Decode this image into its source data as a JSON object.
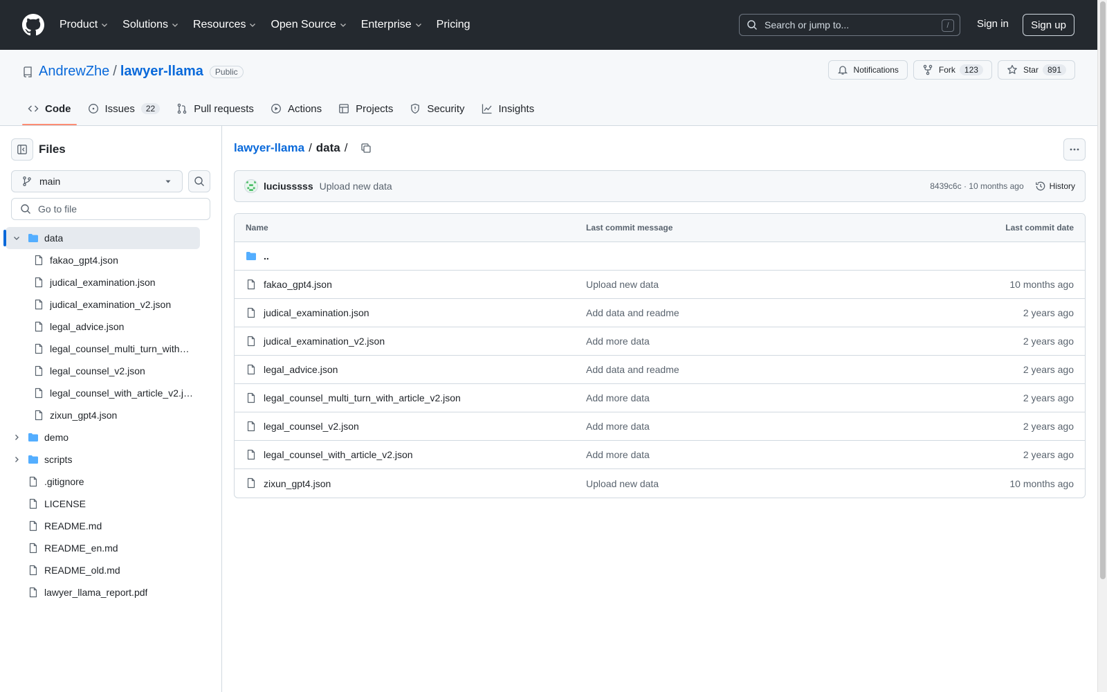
{
  "header": {
    "nav": [
      "Product",
      "Solutions",
      "Resources",
      "Open Source",
      "Enterprise",
      "Pricing"
    ],
    "search_placeholder": "Search or jump to...",
    "search_hint": "/",
    "sign_in": "Sign in",
    "sign_up": "Sign up"
  },
  "repo": {
    "owner": "AndrewZhe",
    "separator": "/",
    "name": "lawyer-llama",
    "visibility": "Public",
    "notifications_label": "Notifications",
    "fork_label": "Fork",
    "fork_count": "123",
    "star_label": "Star",
    "star_count": "891",
    "tabs": {
      "code": "Code",
      "issues": "Issues",
      "issues_count": "22",
      "pulls": "Pull requests",
      "actions": "Actions",
      "projects": "Projects",
      "security": "Security",
      "insights": "Insights"
    }
  },
  "sidebar": {
    "title": "Files",
    "branch": "main",
    "goto_placeholder": "Go to file",
    "tree": [
      {
        "label": "data",
        "type": "folder",
        "open": true,
        "active": true
      },
      {
        "label": "fakao_gpt4.json",
        "type": "file",
        "child": true
      },
      {
        "label": "judical_examination.json",
        "type": "file",
        "child": true
      },
      {
        "label": "judical_examination_v2.json",
        "type": "file",
        "child": true
      },
      {
        "label": "legal_advice.json",
        "type": "file",
        "child": true
      },
      {
        "label": "legal_counsel_multi_turn_with…",
        "type": "file",
        "child": true
      },
      {
        "label": "legal_counsel_v2.json",
        "type": "file",
        "child": true
      },
      {
        "label": "legal_counsel_with_article_v2.j…",
        "type": "file",
        "child": true
      },
      {
        "label": "zixun_gpt4.json",
        "type": "file",
        "child": true
      },
      {
        "label": "demo",
        "type": "folder",
        "open": false
      },
      {
        "label": "scripts",
        "type": "folder",
        "open": false
      },
      {
        "label": ".gitignore",
        "type": "file"
      },
      {
        "label": "LICENSE",
        "type": "file"
      },
      {
        "label": "README.md",
        "type": "file"
      },
      {
        "label": "README_en.md",
        "type": "file"
      },
      {
        "label": "README_old.md",
        "type": "file"
      },
      {
        "label": "lawyer_llama_report.pdf",
        "type": "file"
      }
    ]
  },
  "main": {
    "breadcrumb_repo": "lawyer-llama",
    "breadcrumb_sep": "/",
    "breadcrumb_current": "data",
    "commit": {
      "author": "luciusssss",
      "message": "Upload new data",
      "meta": "8439c6c · 10 months ago",
      "history_label": "History"
    },
    "table": {
      "col_name": "Name",
      "col_message": "Last commit message",
      "col_date": "Last commit date",
      "parent_dir": "..",
      "rows": [
        {
          "name": "fakao_gpt4.json",
          "message": "Upload new data",
          "date": "10 months ago"
        },
        {
          "name": "judical_examination.json",
          "message": "Add data and readme",
          "date": "2 years ago"
        },
        {
          "name": "judical_examination_v2.json",
          "message": "Add more data",
          "date": "2 years ago"
        },
        {
          "name": "legal_advice.json",
          "message": "Add data and readme",
          "date": "2 years ago"
        },
        {
          "name": "legal_counsel_multi_turn_with_article_v2.json",
          "message": "Add more data",
          "date": "2 years ago"
        },
        {
          "name": "legal_counsel_v2.json",
          "message": "Add more data",
          "date": "2 years ago"
        },
        {
          "name": "legal_counsel_with_article_v2.json",
          "message": "Add more data",
          "date": "2 years ago"
        },
        {
          "name": "zixun_gpt4.json",
          "message": "Upload new data",
          "date": "10 months ago"
        }
      ]
    }
  },
  "colors": {
    "header_bg": "#24292f",
    "link": "#0969da",
    "folder": "#54aeff",
    "tab_underline": "#fd8c73"
  }
}
